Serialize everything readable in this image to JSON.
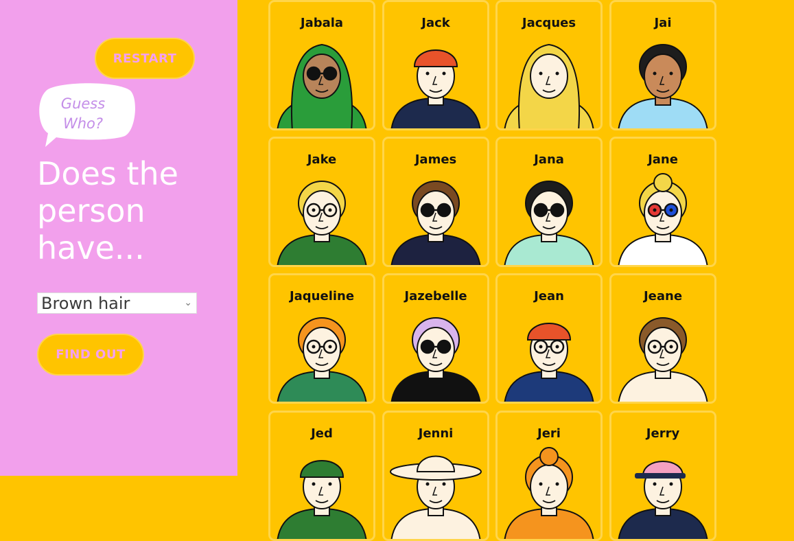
{
  "sidebar": {
    "restart_label": "RESTART",
    "logo_line1": "Guess",
    "logo_line2": "Who?",
    "question": "Does the person have...",
    "select_value": "Brown hair",
    "find_label": "FIND OUT"
  },
  "cards": [
    {
      "name": "Jabala",
      "skin": "#b8845a",
      "hair": "#2a9d3a",
      "shirt": "#2a9d3a",
      "glasses": "dark",
      "hat": "hijab"
    },
    {
      "name": "Jack",
      "skin": "#fdf2e0",
      "hair": "#e8532a",
      "shirt": "#1d2a4d",
      "glasses": "none",
      "hat": "bandana"
    },
    {
      "name": "Jacques",
      "skin": "#fdf2e0",
      "hair": "#f3d648",
      "shirt": "#f3d648",
      "glasses": "none",
      "hat": "hood"
    },
    {
      "name": "Jai",
      "skin": "#c98a5a",
      "hair": "#1d1d1d",
      "shirt": "#9edcf5",
      "glasses": "none",
      "hat": "none"
    },
    {
      "name": "Jake",
      "skin": "#fdf2e0",
      "hair": "#f3d648",
      "shirt": "#2e7d32",
      "glasses": "clear",
      "hat": "none"
    },
    {
      "name": "James",
      "skin": "#fdf2e0",
      "hair": "#7a4a22",
      "shirt": "#1d2240",
      "glasses": "dark",
      "hat": "none"
    },
    {
      "name": "Jana",
      "skin": "#fdf2e0",
      "hair": "#1d1d1d",
      "shirt": "#a9e9d2",
      "glasses": "dark",
      "hat": "none"
    },
    {
      "name": "Jane",
      "skin": "#fdf2e0",
      "hair": "#f3d648",
      "shirt": "#ffffff",
      "glasses": "color",
      "hat": "bun"
    },
    {
      "name": "Jaqueline",
      "skin": "#fdf2e0",
      "hair": "#f5941e",
      "shirt": "#2e8b57",
      "glasses": "clear",
      "hat": "none"
    },
    {
      "name": "Jazebelle",
      "skin": "#fdf2e0",
      "hair": "#d8b4ec",
      "shirt": "#111111",
      "glasses": "dark",
      "hat": "none"
    },
    {
      "name": "Jean",
      "skin": "#fdf2e0",
      "hair": "#e8532a",
      "shirt": "#1d3a7a",
      "glasses": "clear",
      "hat": "beanie"
    },
    {
      "name": "Jeane",
      "skin": "#fdf2e0",
      "hair": "#8a5a2a",
      "shirt": "#fdf2e0",
      "glasses": "clear",
      "hat": "none"
    },
    {
      "name": "Jed",
      "skin": "#fdf2e0",
      "hair": "#2e7d32",
      "shirt": "#2e7d32",
      "glasses": "none",
      "hat": "beanie"
    },
    {
      "name": "Jenni",
      "skin": "#fdf2e0",
      "hair": "#fdf2e0",
      "shirt": "#fdf2e0",
      "glasses": "none",
      "hat": "sunhat"
    },
    {
      "name": "Jeri",
      "skin": "#fdf2e0",
      "hair": "#f5941e",
      "shirt": "#f5941e",
      "glasses": "none",
      "hat": "bun"
    },
    {
      "name": "Jerry",
      "skin": "#fdf2e0",
      "hair": "#f4a0c0",
      "shirt": "#1d2a4d",
      "glasses": "none",
      "hat": "cap"
    }
  ]
}
